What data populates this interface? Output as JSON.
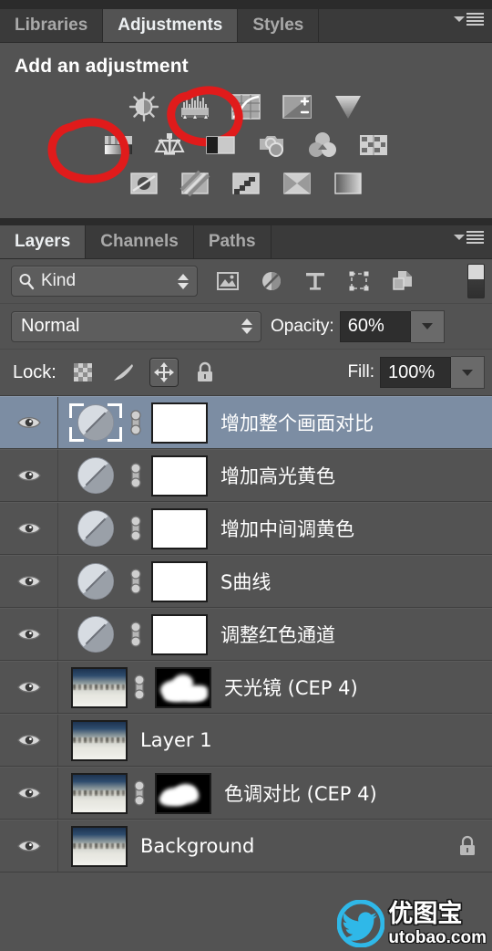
{
  "adjustments_panel": {
    "tabs": [
      {
        "label": "Libraries",
        "active": false
      },
      {
        "label": "Adjustments",
        "active": true
      },
      {
        "label": "Styles",
        "active": false
      }
    ],
    "menu_icon": "panel-menu-icon",
    "title": "Add an adjustment",
    "icon_rows": [
      [
        {
          "name": "brightness-contrast-icon"
        },
        {
          "name": "levels-icon"
        },
        {
          "name": "curves-icon",
          "annotated": true
        },
        {
          "name": "exposure-icon"
        },
        {
          "name": "vibrance-icon"
        }
      ],
      [
        {
          "name": "hue-saturation-icon"
        },
        {
          "name": "color-balance-icon",
          "annotated": true
        },
        {
          "name": "black-and-white-icon"
        },
        {
          "name": "photo-filter-icon"
        },
        {
          "name": "channel-mixer-icon"
        },
        {
          "name": "color-lookup-icon"
        }
      ],
      [
        {
          "name": "invert-icon"
        },
        {
          "name": "posterize-icon"
        },
        {
          "name": "threshold-icon"
        },
        {
          "name": "gradient-map-icon"
        },
        {
          "name": "selective-color-icon"
        }
      ]
    ],
    "annotation_color": "#e01b1b"
  },
  "layers_panel": {
    "tabs": [
      {
        "label": "Layers",
        "active": true
      },
      {
        "label": "Channels",
        "active": false
      },
      {
        "label": "Paths",
        "active": false
      }
    ],
    "menu_icon": "panel-menu-icon",
    "filter": {
      "search_icon": "search-icon",
      "kind_label": "Kind",
      "type_filters": [
        {
          "name": "filter-pixel-icon"
        },
        {
          "name": "filter-adjustment-icon"
        },
        {
          "name": "filter-type-icon"
        },
        {
          "name": "filter-shape-icon"
        },
        {
          "name": "filter-smart-object-icon"
        }
      ],
      "toggle_name": "filter-enable-toggle"
    },
    "blend": {
      "mode": "Normal",
      "opacity_label": "Opacity:",
      "opacity_value": "60%",
      "fill_label": "Fill:",
      "fill_value": "100%"
    },
    "lock": {
      "label": "Lock:",
      "items": [
        {
          "name": "lock-transparent-pixels-icon",
          "active": false
        },
        {
          "name": "lock-image-pixels-icon",
          "active": false
        },
        {
          "name": "lock-position-icon",
          "active": true
        },
        {
          "name": "lock-all-icon",
          "active": false
        }
      ]
    },
    "layers": [
      {
        "name": "增加整个画面对比",
        "type": "adjustment",
        "selected": true,
        "visible": true,
        "linked": true,
        "mask": "white",
        "locked": false
      },
      {
        "name": "增加高光黄色",
        "type": "adjustment",
        "selected": false,
        "visible": true,
        "linked": true,
        "mask": "white",
        "locked": false
      },
      {
        "name": "增加中间调黄色",
        "type": "adjustment",
        "selected": false,
        "visible": true,
        "linked": true,
        "mask": "white",
        "locked": false
      },
      {
        "name": "S曲线",
        "type": "adjustment",
        "selected": false,
        "visible": true,
        "linked": true,
        "mask": "white",
        "locked": false
      },
      {
        "name": "调整红色通道",
        "type": "adjustment",
        "selected": false,
        "visible": true,
        "linked": true,
        "mask": "white",
        "locked": false
      },
      {
        "name": "天光镜 (CEP 4)",
        "type": "pixel",
        "selected": false,
        "visible": true,
        "linked": true,
        "mask": "black",
        "locked": false
      },
      {
        "name": "Layer 1",
        "type": "pixel",
        "selected": false,
        "visible": true,
        "linked": false,
        "mask": "none",
        "locked": false
      },
      {
        "name": "色调对比 (CEP 4)",
        "type": "pixel",
        "selected": false,
        "visible": true,
        "linked": true,
        "mask": "black",
        "locked": false
      },
      {
        "name": "Background",
        "type": "pixel",
        "selected": false,
        "visible": true,
        "linked": false,
        "mask": "none",
        "locked": true
      }
    ],
    "eye_icon": "visibility-eye-icon",
    "link_icon": "link-mask-icon",
    "lock_badge_icon": "lock-icon"
  },
  "watermark": {
    "logo_icon": "bird-logo-icon",
    "cn_text": "优图宝",
    "en_text": "utobao.com",
    "brand_color": "#2fb8e8"
  }
}
